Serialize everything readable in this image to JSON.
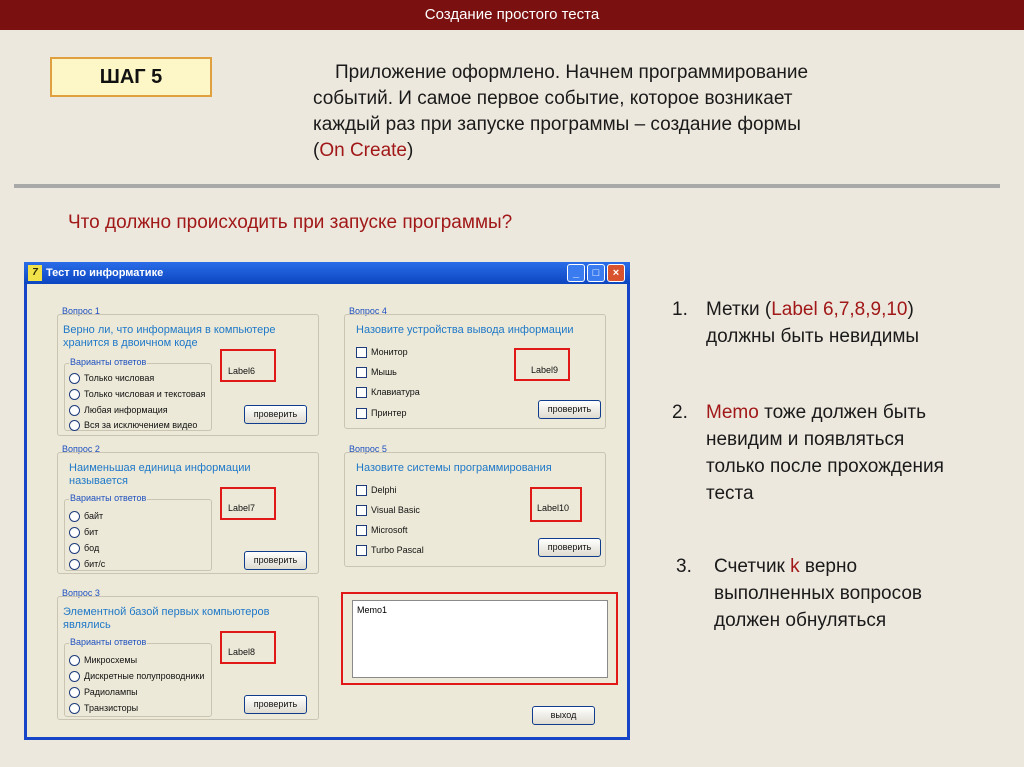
{
  "header": {
    "title": "Создание простого теста"
  },
  "step": {
    "label": "ШАГ 5"
  },
  "intro": {
    "line1": "Приложение оформлено. Начнем программирование",
    "line2": "событий. И самое первое событие, которое возникает",
    "line3": "каждый раз при запуске программы – создание формы",
    "line4_open": "(",
    "line4_red": "On Create",
    "line4_close": ")"
  },
  "question": {
    "text": "Что должно происходить при запуске программы?"
  },
  "window": {
    "title": "Тест по информатике",
    "min": "_",
    "max": "□",
    "close": "×"
  },
  "q1": {
    "label": "Вопрос 1",
    "text": "Верно ли, что информация в компьютере хранится в двоичном коде",
    "variants": "Варианты ответов",
    "options": [
      "Только числовая",
      "Только числовая и текстовая",
      "Любая информация",
      "Вся за исключением видео"
    ],
    "result": "Label6",
    "check": "проверить"
  },
  "q2": {
    "label": "Вопрос 2",
    "text": "Наименьшая единица информации называется",
    "variants": "Варианты ответов",
    "options": [
      "байт",
      "бит",
      "бод",
      "бит/с"
    ],
    "result": "Label7",
    "check": "проверить"
  },
  "q3": {
    "label": "Вопрос 3",
    "text": "Элементной базой первых компьютеров являлись",
    "variants": "Варианты ответов",
    "options": [
      "Микросхемы",
      "Дискретные полупроводники",
      "Радиолампы",
      "Транзисторы"
    ],
    "result": "Label8",
    "check": "проверить"
  },
  "q4": {
    "label": "Вопрос 4",
    "text": "Назовите устройства вывода информации",
    "options": [
      "Монитор",
      "Мышь",
      "Клавиатура",
      "Принтер"
    ],
    "result": "Label9",
    "check": "проверить"
  },
  "q5": {
    "label": "Вопрос 5",
    "text": "Назовите системы программирования",
    "options": [
      "Delphi",
      "Visual Basic",
      "Microsoft",
      "Turbo Pascal"
    ],
    "result": "Label10",
    "check": "проверить"
  },
  "memo": {
    "text": "Memo1"
  },
  "exit": {
    "label": "выход"
  },
  "points": [
    {
      "num": "1.",
      "a": "Метки (",
      "b": "Label 6,7,8,9,10",
      "c": ")",
      "d": "должны быть невидимы"
    },
    {
      "num": "2.",
      "a": "Memo",
      "b": " тоже должен быть",
      "c": "невидим и появляться",
      "d": "только после прохождения",
      "e": "теста"
    },
    {
      "num": "3.",
      "a": "Счетчик ",
      "b": "k",
      "c": " верно",
      "d": "выполненных вопросов",
      "e": "должен обнуляться"
    }
  ]
}
